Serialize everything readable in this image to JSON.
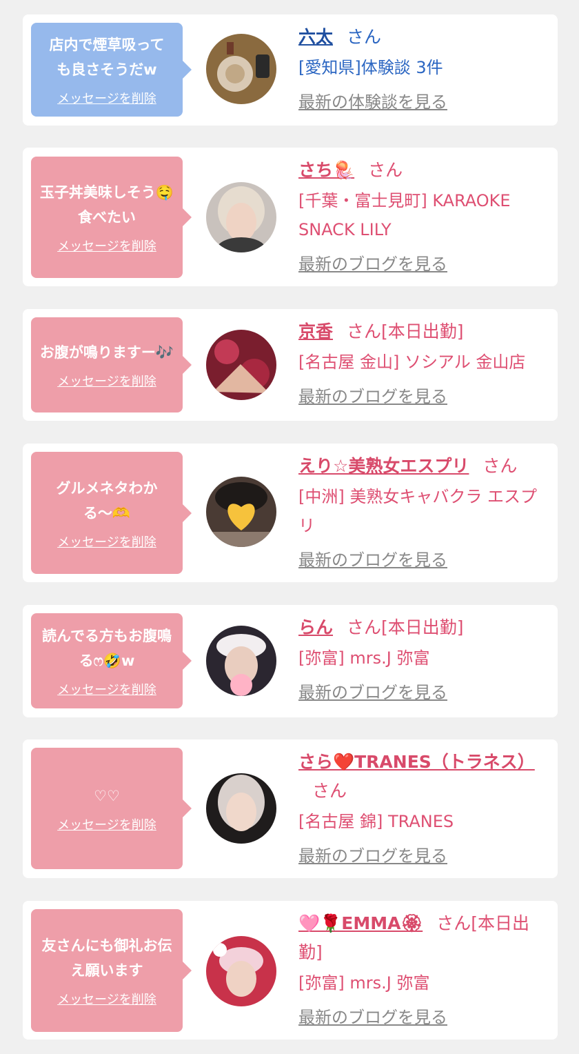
{
  "messages": [
    {
      "bubble_text": "店内で煙草吸っても良さそうだw",
      "delete_label": "メッセージを削除",
      "name": "六太",
      "san": "さん",
      "shop": "[愛知県]体験談 3件",
      "more_label": "最新の体験談を見る",
      "theme_color": "#96b9ec"
    },
    {
      "bubble_text": "玉子丼美味しそう🤤食べたい",
      "delete_label": "メッセージを削除",
      "name": "さち🪼",
      "san": "さん",
      "shop": "[千葉・富士見町] KARAOKE SNACK LILY",
      "more_label": "最新のブログを見る",
      "theme_color": "#ee9ea9"
    },
    {
      "bubble_text": "お腹が鳴りますー🎶",
      "delete_label": "メッセージを削除",
      "name": "京香",
      "san": "さん[本日出勤]",
      "shop": "[名古屋 金山] ソシアル 金山店",
      "more_label": "最新のブログを見る",
      "theme_color": "#ee9ea9"
    },
    {
      "bubble_text": "グルメネタわかる〜🫶",
      "delete_label": "メッセージを削除",
      "name": "えり☆美熟女エスプリ",
      "san": "さん",
      "shop": "[中洲] 美熟女キャバクラ エスプリ",
      "more_label": "最新のブログを見る",
      "theme_color": "#ee9ea9"
    },
    {
      "bubble_text": "読んでる方もお腹鳴るෆ🤣w",
      "delete_label": "メッセージを削除",
      "name": "らん",
      "san": "さん[本日出勤]",
      "shop": "[弥富] mrs.J 弥富",
      "more_label": "最新のブログを見る",
      "theme_color": "#ee9ea9"
    },
    {
      "bubble_text": "♡♡",
      "delete_label": "メッセージを削除",
      "name": "さら❤️TRANES（トラネス）",
      "san": "さん",
      "shop": "[名古屋 錦] TRANES",
      "more_label": "最新のブログを見る",
      "theme_color": "#ee9ea9"
    },
    {
      "bubble_text": "友さんにも御礼お伝え願います",
      "delete_label": "メッセージを削除",
      "name": "🩷🌹EMMA🏵",
      "san": "さん[本日出勤]",
      "shop": "[弥富] mrs.J 弥富",
      "more_label": "最新のブログを見る",
      "theme_color": "#ee9ea9"
    }
  ]
}
